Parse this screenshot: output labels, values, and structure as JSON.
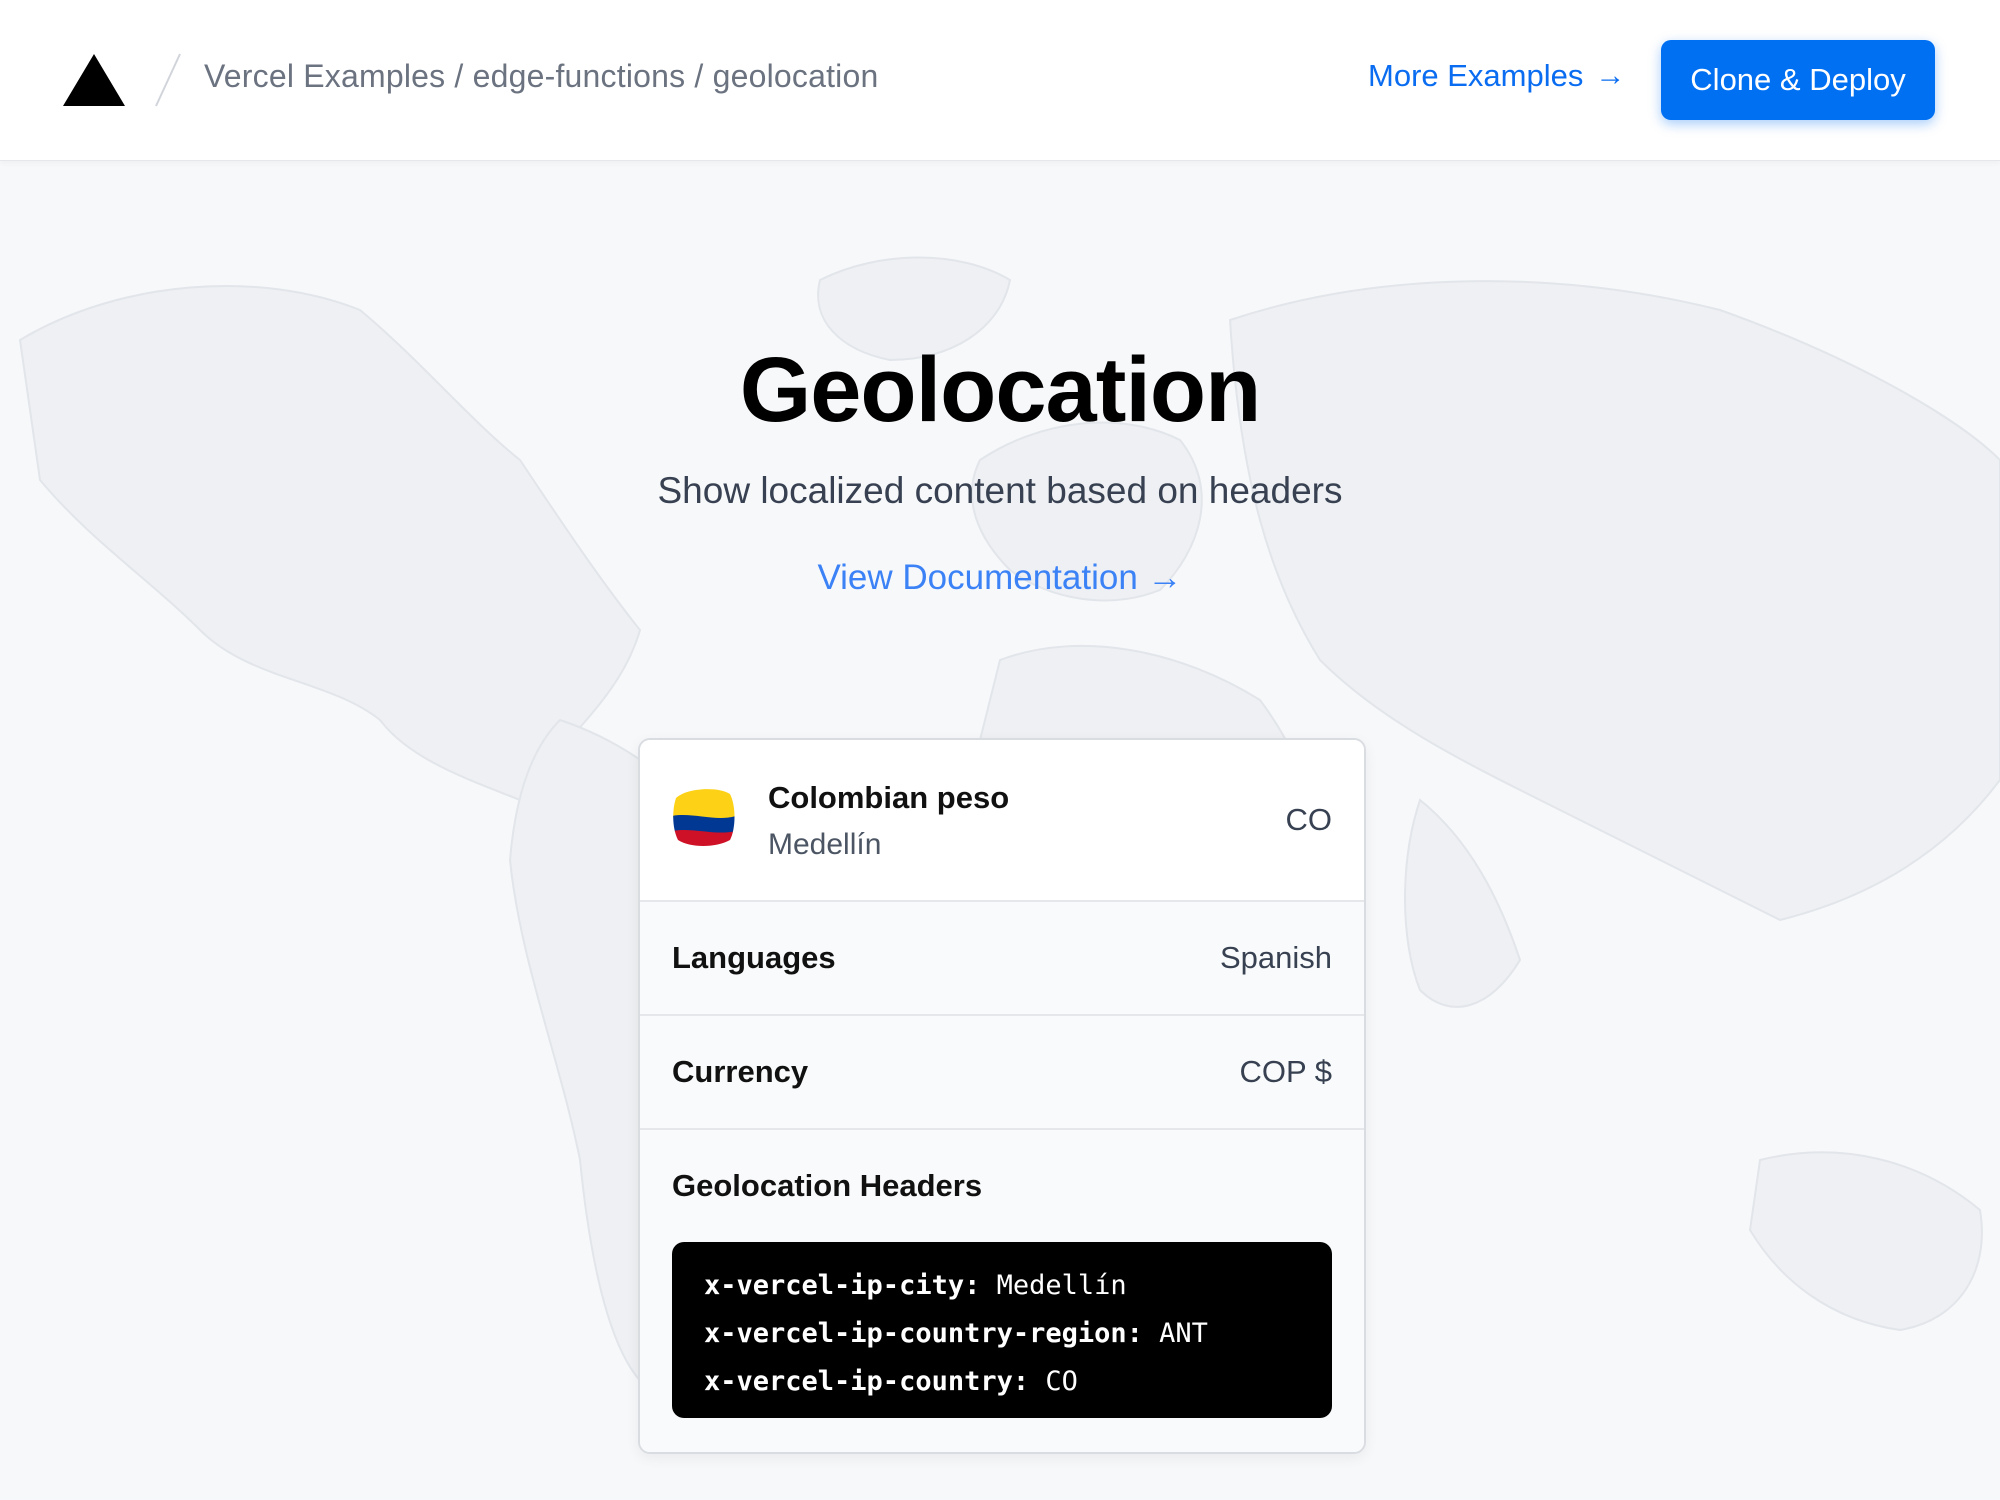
{
  "header": {
    "breadcrumb": "Vercel Examples / edge-functions / geolocation",
    "more_examples": "More Examples",
    "more_examples_arrow": "→",
    "deploy_button": "Clone & Deploy"
  },
  "hero": {
    "title": "Geolocation",
    "subtitle": "Show localized content based on headers",
    "doc_link": "View Documentation",
    "doc_link_arrow": "→"
  },
  "card": {
    "country_name": "Colombian peso",
    "city": "Medellín",
    "country_code": "CO",
    "rows": [
      {
        "label": "Languages",
        "value": "Spanish"
      },
      {
        "label": "Currency",
        "value": "COP $"
      }
    ],
    "headers_title": "Geolocation Headers",
    "headers": [
      {
        "key": "x-vercel-ip-city:",
        "value": "Medellín"
      },
      {
        "key": "x-vercel-ip-country-region:",
        "value": "ANT"
      },
      {
        "key": "x-vercel-ip-country:",
        "value": "CO"
      }
    ]
  },
  "colors": {
    "accent": "#0070f3",
    "link": "#3b82f6",
    "flag": [
      "#fcd116",
      "#003893",
      "#ce1126"
    ]
  }
}
